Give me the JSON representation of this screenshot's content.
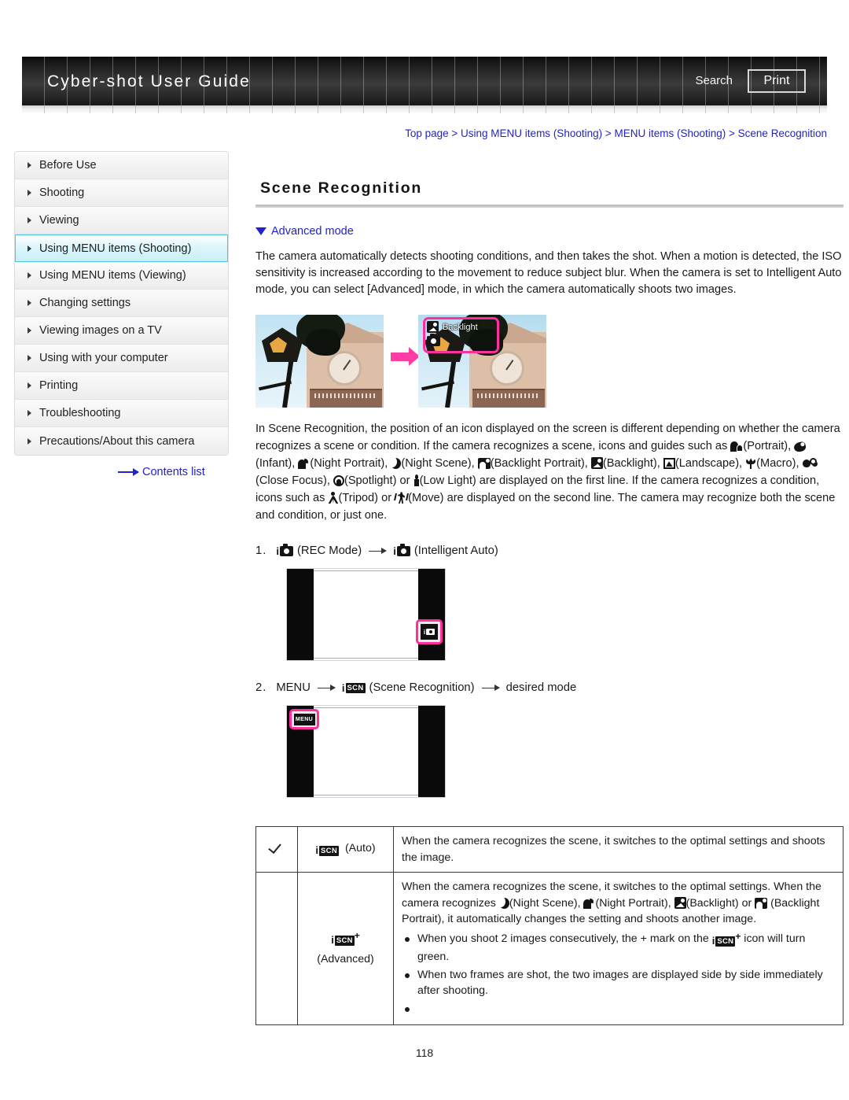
{
  "header": {
    "title": "Cyber-shot User Guide",
    "search_label": "Search",
    "print_label": "Print"
  },
  "breadcrumb": "Top page > Using MENU items (Shooting) > MENU items (Shooting) > Scene Recognition",
  "sidebar": {
    "items": [
      {
        "label": "Before Use",
        "active": false
      },
      {
        "label": "Shooting",
        "active": false
      },
      {
        "label": "Viewing",
        "active": false
      },
      {
        "label": "Using MENU items (Shooting)",
        "active": true
      },
      {
        "label": "Using MENU items (Viewing)",
        "active": false
      },
      {
        "label": "Changing settings",
        "active": false
      },
      {
        "label": "Viewing images on a TV",
        "active": false
      },
      {
        "label": "Using with your computer",
        "active": false
      },
      {
        "label": "Printing",
        "active": false
      },
      {
        "label": "Troubleshooting",
        "active": false
      },
      {
        "label": "Precautions/About this camera",
        "active": false
      }
    ],
    "contents_link": "Contents list"
  },
  "main": {
    "page_title": "Scene Recognition",
    "advanced_mode_link": "Advanced mode",
    "intro_paragraph": "The camera automatically detects shooting conditions, and then takes the shot. When a motion is detected, the ISO sensitivity is increased according to the movement to reduce subject blur. When the camera is set to Intelligent Auto mode, you can select [Advanced] mode, in which the camera automatically shoots two images.",
    "illustration": {
      "callout_label": "Backlight"
    },
    "body_p1": "In Scene Recognition, the position of an icon displayed on the screen is different depending on whether the camera recognizes a scene or condition. If the camera recognizes a scene, icons and guides such",
    "body_as": "as",
    "scene_icons": [
      {
        "icon": "portrait-icon",
        "label": "(Portrait),"
      },
      {
        "icon": "infant-icon",
        "label": "(Infant),"
      },
      {
        "icon": "night-portrait-icon",
        "label": "(Night Portrait),"
      },
      {
        "icon": "night-scene-icon",
        "label": "(Night Scene),"
      },
      {
        "icon": "backlight-portrait-icon",
        "label": "(Backlight Portrait),"
      },
      {
        "icon": "backlight-icon",
        "label": "(Backlight),"
      },
      {
        "icon": "landscape-icon",
        "label": "(Landscape),"
      },
      {
        "icon": "macro-icon",
        "label": "(Macro),"
      },
      {
        "icon": "close-focus-icon",
        "label": "(Close Focus),"
      },
      {
        "icon": "spotlight-icon",
        "label": "(Spotlight) or"
      },
      {
        "icon": "low-light-icon",
        "label": "(Low Light) are displayed on the first"
      }
    ],
    "body_p2_a": "line. If the camera recognizes a condition, icons such as",
    "condition_icons": [
      {
        "icon": "tripod-icon",
        "label": "(Tripod) or"
      },
      {
        "icon": "move-icon",
        "label": "(Move) are displayed on the"
      }
    ],
    "body_p2_b": "second line. The camera may recognize both the scene and condition, or just one.",
    "steps": [
      {
        "num": "1.",
        "parts": [
          "(REC Mode)",
          "(Intelligent Auto)"
        ]
      },
      {
        "num": "2.",
        "menu_label": "MENU",
        "parts": [
          "(Scene Recognition)",
          "desired mode"
        ]
      }
    ],
    "lcd": {
      "rec_button_name": "REC Mode button",
      "menu_button_label": "MENU"
    },
    "table": {
      "rows": [
        {
          "checked": true,
          "icon_type": "iscn",
          "icon_label": "(Auto)",
          "text": "When the camera recognizes the scene, it switches to the optimal settings and shoots the image.",
          "bullets": []
        },
        {
          "checked": false,
          "icon_type": "iscn-plus",
          "icon_label": "(Advanced)",
          "text_a": "When the camera recognizes the scene, it switches to the optimal settings. When the camera recognizes",
          "inline": [
            {
              "icon": "night-scene-icon",
              "label": "(Night Scene),"
            },
            {
              "icon": "night-portrait-icon",
              "label": "(Night Portrait),"
            },
            {
              "icon": "backlight-icon",
              "label": "(Backlight) or"
            },
            {
              "icon": "backlight-portrait-icon",
              "label": ""
            }
          ],
          "text_b": "(Backlight Portrait), it automatically changes the setting and shoots another image.",
          "bullet_1_a": "When you shoot 2 images consecutively, the + mark on the",
          "bullet_1_b": "icon will turn green.",
          "bullet_2": "When two frames are shot, the two images are displayed side by side immediately after shooting."
        }
      ]
    },
    "page_number": "118"
  },
  "colors": {
    "link": "#2222cc",
    "accent_pink": "#ff2fa0",
    "active_nav": "#c9f0f8"
  }
}
